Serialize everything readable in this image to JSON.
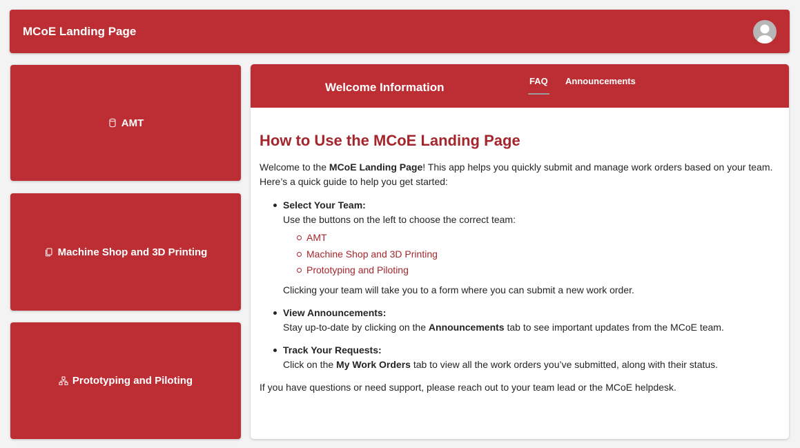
{
  "header": {
    "title": "MCoE Landing Page",
    "avatar_icon": "user-avatar-icon"
  },
  "teams": [
    {
      "label": "AMT",
      "icon": "database-icon"
    },
    {
      "label": "Machine Shop and 3D Printing",
      "icon": "copy-icon"
    },
    {
      "label": "Prototyping and Piloting",
      "icon": "flow-icon"
    }
  ],
  "panel": {
    "title": "Welcome Information",
    "tabs": [
      {
        "label": "FAQ",
        "selected": true
      },
      {
        "label": "Announcements",
        "selected": false
      }
    ]
  },
  "faq": {
    "heading": "How to Use the MCoE Landing Page",
    "intro_prefix": "Welcome to the ",
    "intro_bold": "MCoE Landing Page",
    "intro_suffix": "! This app helps you quickly submit and manage work orders based on your team. Here’s a quick guide to help you get started:",
    "items": [
      {
        "title": "Select Your Team:",
        "text": "Use the buttons on the left to choose the correct team:",
        "links": [
          "AMT",
          "Machine Shop and 3D Printing",
          "Prototyping and Piloting"
        ],
        "after": "Clicking your team will take you to a form where you can submit a new work order."
      },
      {
        "title": "View Announcements:",
        "text_prefix": "Stay up-to-date by clicking on the ",
        "text_bold": "Announcements",
        "text_suffix": " tab to see important updates from the MCoE team."
      },
      {
        "title": "Track Your Requests:",
        "text_prefix": "Click on the ",
        "text_bold": "My Work Orders",
        "text_suffix": " tab to view all the work orders you’ve submitted, along with their status."
      }
    ],
    "closing": "If you have questions or need support, please reach out to your team lead or the MCoE helpdesk."
  },
  "colors": {
    "brand": "#bc2e34",
    "accent_text": "#a4262c",
    "background": "#f3f3f3"
  }
}
